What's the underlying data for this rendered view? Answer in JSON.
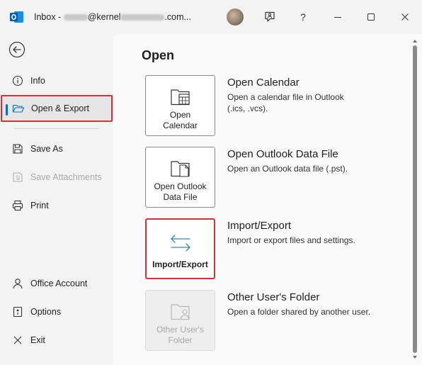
{
  "window": {
    "title_prefix": "Inbox - ",
    "title_domain": "@kernel",
    "title_suffix": ".com...",
    "help_label": "?"
  },
  "sidebar": {
    "items": [
      {
        "label": "Info",
        "icon": "info-icon"
      },
      {
        "label": "Open & Export",
        "icon": "folder-open-icon"
      },
      {
        "label": "Save As",
        "icon": "save-as-icon"
      },
      {
        "label": "Save Attachments",
        "icon": "save-attachments-icon"
      },
      {
        "label": "Print",
        "icon": "printer-icon"
      },
      {
        "label": "Office Account",
        "icon": "person-icon"
      },
      {
        "label": "Options",
        "icon": "options-icon"
      },
      {
        "label": "Exit",
        "icon": "exit-icon"
      }
    ]
  },
  "main": {
    "title": "Open",
    "options": [
      {
        "card_line1": "Open",
        "card_line2": "Calendar",
        "title": "Open Calendar",
        "desc_line1": "Open a calendar file in Outlook",
        "desc_line2": "(.ics, .vcs)."
      },
      {
        "card_line1": "Open Outlook",
        "card_line2": "Data File",
        "title": "Open Outlook Data File",
        "desc_line1": "Open an Outlook data file (.pst).",
        "desc_line2": ""
      },
      {
        "card_line1": "Import/Export",
        "card_line2": "",
        "title": "Import/Export",
        "desc_line1": "Import or export files and settings.",
        "desc_line2": ""
      },
      {
        "card_line1": "Other User's",
        "card_line2": "Folder",
        "title": "Other User's Folder",
        "desc_line1": "Open a folder shared by another user.",
        "desc_line2": ""
      }
    ]
  },
  "colors": {
    "accent": "#0f6cbd",
    "highlight_border": "#d13438",
    "import_export_arrows": "#2e8fb0"
  }
}
